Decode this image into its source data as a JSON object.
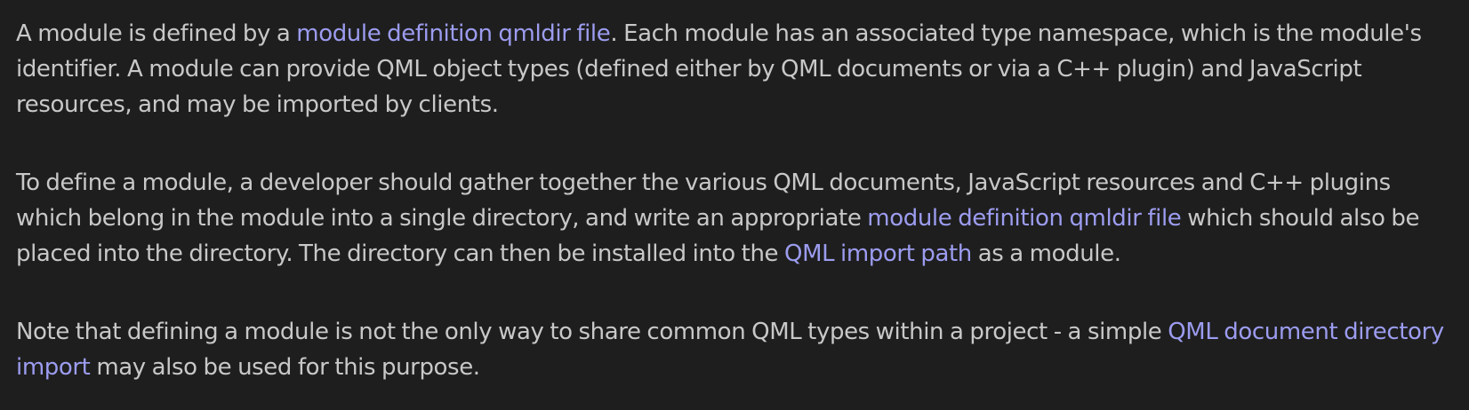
{
  "paragraphs": [
    {
      "segments": [
        {
          "text": "A module is defined by a "
        },
        {
          "text": "module definition qmldir file",
          "link": true
        },
        {
          "text": ". Each module has an associated type namespace, which is the module's identifier. A module can provide QML object types (defined either by QML documents or via a C++ plugin) and JavaScript resources, and may be imported by clients."
        }
      ]
    },
    {
      "segments": [
        {
          "text": "To define a module, a developer should gather together the various QML documents, JavaScript resources and C++ plugins which belong in the module into a single directory, and write an appropriate "
        },
        {
          "text": "module definition qmldir file",
          "link": true
        },
        {
          "text": " which should also be placed into the directory. The directory can then be installed into the "
        },
        {
          "text": "QML import path",
          "link": true
        },
        {
          "text": " as a module."
        }
      ]
    },
    {
      "segments": [
        {
          "text": "Note that defining a module is not the only way to share common QML types within a project - a simple "
        },
        {
          "text": "QML document directory import",
          "link": true
        },
        {
          "text": " may also be used for this purpose."
        }
      ]
    }
  ],
  "colors": {
    "background": "#1e1e1e",
    "text": "#c8c8c8",
    "link": "#9c9cf0"
  }
}
